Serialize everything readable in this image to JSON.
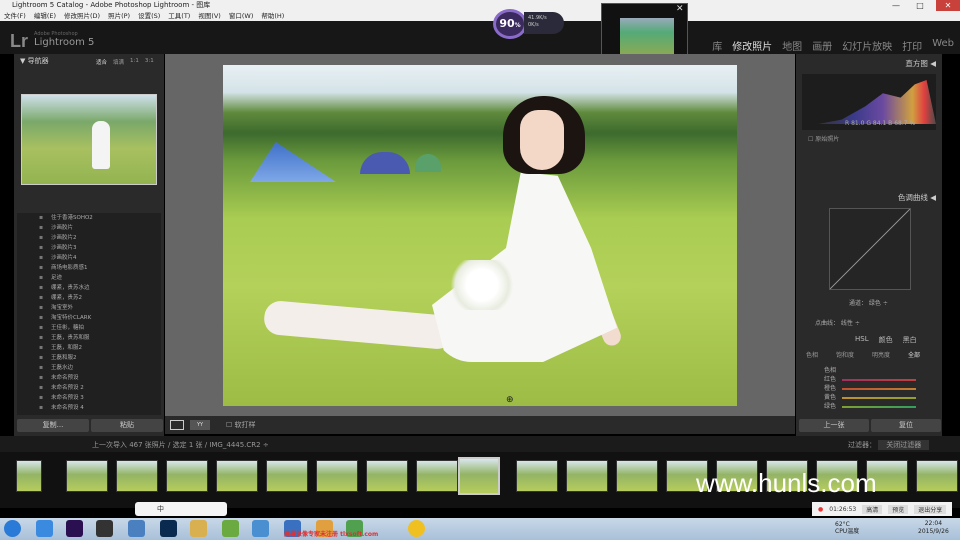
{
  "window": {
    "title": "Lightroom 5 Catalog - Adobe Photoshop Lightroom - 图库",
    "minimize": "—",
    "maximize": "□",
    "close": "✕"
  },
  "menu": [
    "文件(F)",
    "编辑(E)",
    "修改照片(D)",
    "照片(P)",
    "设置(S)",
    "工具(T)",
    "视图(V)",
    "窗口(W)",
    "帮助(H)"
  ],
  "header": {
    "logo": "Lr",
    "brand_small": "Adobe Photoshop",
    "product": "Lightroom 5"
  },
  "modules": [
    "库",
    "修改照片",
    "地图",
    "画册",
    "幻灯片放映",
    "打印",
    "Web"
  ],
  "active_module": "修改照片",
  "gauge": {
    "value": "90",
    "unit": "%",
    "up": "41.9K/s",
    "down": "0K/s"
  },
  "navigator": {
    "title": "导航器",
    "options": [
      "适合",
      "填满",
      "1:1",
      "3:1"
    ]
  },
  "presets": [
    "住于香港SOHO2",
    "沙画胶片",
    "沙画胶片2",
    "沙画胶片3",
    "沙画胶片4",
    "商场电影质感1",
    "足迹",
    "绷紧，贵苏水边",
    "绷紧，贵苏2",
    "淘宝室外",
    "淘宝特价CLARK",
    "王佳彬，糖拍",
    "王磊，贵苏和服",
    "王磊，和服2",
    "王磊和服2",
    "王磊水边",
    "未命名预设",
    "未命名预设 2",
    "未命名预设 3",
    "未命名预设 4"
  ],
  "left_buttons": {
    "copy": "复制...",
    "paste": "粘贴"
  },
  "toolbar": {
    "soft_proof": "软打样"
  },
  "right_panel": {
    "histogram_title": "直方图",
    "rgb_values": "R 81.0 G 84.1 B 68.7 %",
    "original_photo": "原始照片",
    "tone_curve_title": "色调曲线",
    "curve_channel": "通道： 绿色 ÷",
    "point_curve": "点曲线： 线性 ÷",
    "hsl_header": [
      "HSL",
      "颜色",
      "黑白"
    ],
    "hsl_tabs": [
      "色相",
      "饱和度",
      "明亮度",
      "全部"
    ],
    "hsl_group": "色相",
    "hsl_colors": [
      "红色",
      "橙色",
      "黄色",
      "绿色"
    ]
  },
  "right_buttons": {
    "previous": "上一张",
    "reset": "复位"
  },
  "filmstrip": {
    "source": "上一次导入 467 张照片 / 选定 1 张 / IMG_4445.CR2 ÷",
    "filter_label": "过滤器：",
    "filter_value": "关闭过滤器"
  },
  "watermark": "www.hunls.com",
  "ime": {
    "label": "中"
  },
  "recording": {
    "time": "01:26:53",
    "items": [
      "高清",
      "预览",
      "退出分享"
    ]
  },
  "taskbar": {
    "ad": "屏幕录像专家未注册 tlxsoft.com",
    "cpu_temp": "62°C",
    "cpu_label": "CPU温度",
    "time": "22:04",
    "date": "2015/9/26"
  }
}
